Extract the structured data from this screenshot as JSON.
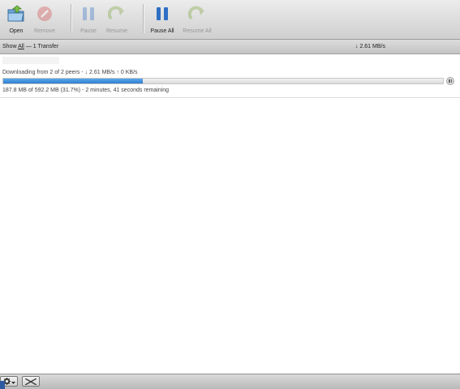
{
  "toolbar": {
    "buttons": [
      {
        "label": "Open",
        "icon": "folder-open-icon",
        "enabled": true
      },
      {
        "label": "Remove",
        "icon": "remove-icon",
        "enabled": false
      },
      {
        "label": "Pause",
        "icon": "pause-icon",
        "enabled": false
      },
      {
        "label": "Resume",
        "icon": "resume-icon",
        "enabled": false
      },
      {
        "label": "Pause All",
        "icon": "pause-all-icon",
        "enabled": true
      },
      {
        "label": "Resume All",
        "icon": "resume-all-icon",
        "enabled": false
      }
    ]
  },
  "filter": {
    "show_prefix": "Show",
    "show_value": "All",
    "transfer_count": "— 1 Transfer",
    "total_rate": "↓ 2.61 MB/s"
  },
  "transfer": {
    "status": "Downloading from 2 of 2 peers - ↓ 2.61 MB/s ↑ 0 KB/s",
    "progress_percent": 31.7,
    "info": "187.8 MB of 592.2 MB (31.7%) - 2 minutes, 41 seconds remaining"
  },
  "colors": {
    "progress": "#3d8fdd",
    "toolbar_blue": "#2f6fc4",
    "remove_red": "#d24b4b",
    "resume_green": "#7aa23a"
  }
}
